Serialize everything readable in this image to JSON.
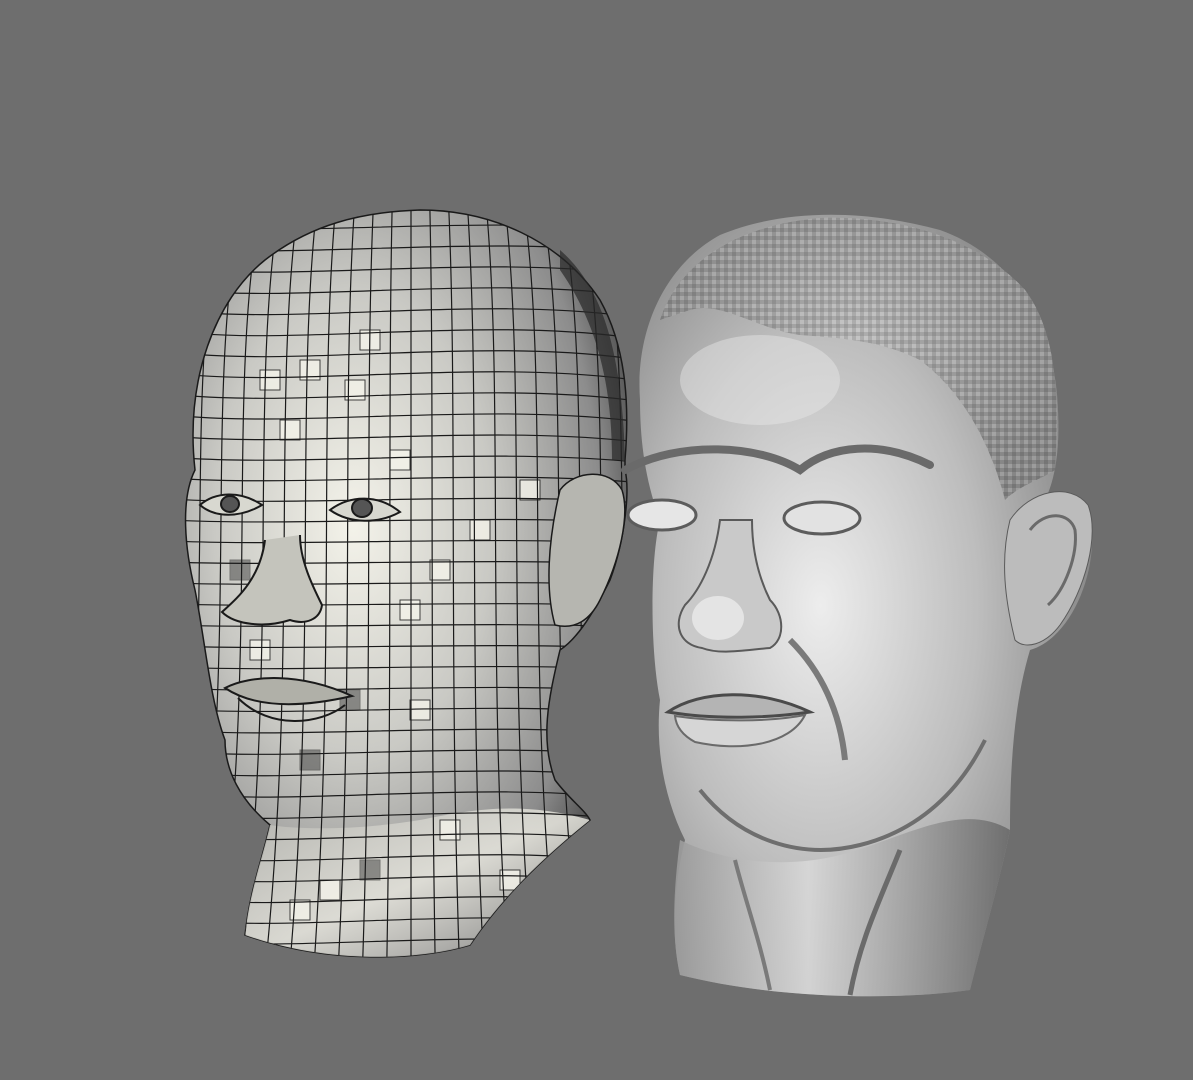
{
  "viewport": {
    "background_color": "#6e6e6e"
  },
  "models": [
    {
      "id": "wireframe-head",
      "shading": "flat-quad-wireframe",
      "edge_color": "#1a1a1a",
      "face_light": "#f4f3ea",
      "face_mid": "#a8a8a8",
      "face_dark": "#3c3c3c"
    },
    {
      "id": "sculpted-head",
      "shading": "smooth-metallic",
      "highlight": "#ededed",
      "midtone": "#a6a6a6",
      "shadow": "#3a3a3a"
    }
  ]
}
